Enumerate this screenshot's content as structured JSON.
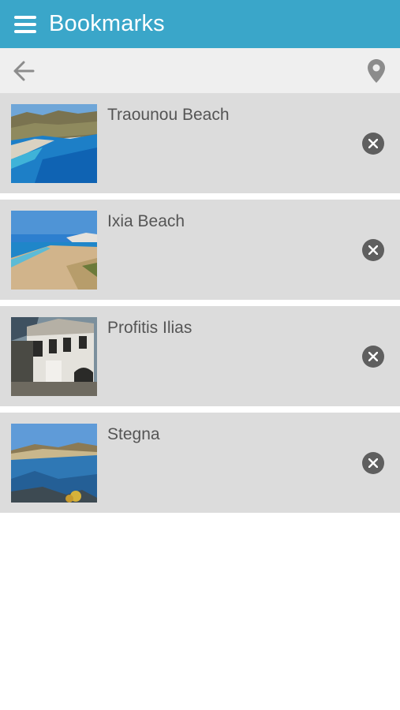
{
  "header": {
    "title": "Bookmarks",
    "menu_icon": "hamburger-menu-icon",
    "background": "#3aa6c9"
  },
  "toolbar": {
    "back_icon": "arrow-left-icon",
    "map_icon": "map-pin-icon"
  },
  "bookmarks": [
    {
      "title": "Traounou Beach",
      "thumbnail": "beach-photo",
      "remove_icon": "close-circle-icon"
    },
    {
      "title": "Ixia Beach",
      "thumbnail": "beach-photo",
      "remove_icon": "close-circle-icon"
    },
    {
      "title": "Profitis Ilias",
      "thumbnail": "building-photo",
      "remove_icon": "close-circle-icon"
    },
    {
      "title": "Stegna",
      "thumbnail": "bay-photo",
      "remove_icon": "close-circle-icon"
    }
  ]
}
